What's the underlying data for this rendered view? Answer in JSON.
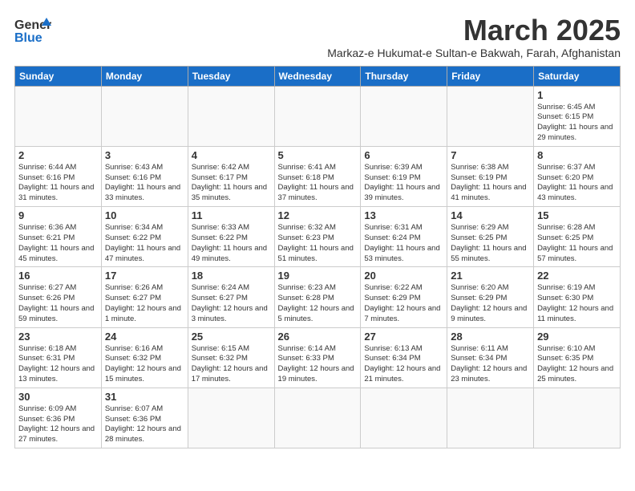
{
  "header": {
    "logo_line1": "General",
    "logo_line2": "Blue",
    "main_title": "March 2025",
    "subtitle": "Markaz-e Hukumat-e Sultan-e Bakwah, Farah, Afghanistan"
  },
  "days_of_week": [
    "Sunday",
    "Monday",
    "Tuesday",
    "Wednesday",
    "Thursday",
    "Friday",
    "Saturday"
  ],
  "weeks": [
    [
      {
        "day": "",
        "info": ""
      },
      {
        "day": "",
        "info": ""
      },
      {
        "day": "",
        "info": ""
      },
      {
        "day": "",
        "info": ""
      },
      {
        "day": "",
        "info": ""
      },
      {
        "day": "",
        "info": ""
      },
      {
        "day": "1",
        "info": "Sunrise: 6:45 AM\nSunset: 6:15 PM\nDaylight: 11 hours and 29 minutes."
      }
    ],
    [
      {
        "day": "2",
        "info": "Sunrise: 6:44 AM\nSunset: 6:16 PM\nDaylight: 11 hours and 31 minutes."
      },
      {
        "day": "3",
        "info": "Sunrise: 6:43 AM\nSunset: 6:16 PM\nDaylight: 11 hours and 33 minutes."
      },
      {
        "day": "4",
        "info": "Sunrise: 6:42 AM\nSunset: 6:17 PM\nDaylight: 11 hours and 35 minutes."
      },
      {
        "day": "5",
        "info": "Sunrise: 6:41 AM\nSunset: 6:18 PM\nDaylight: 11 hours and 37 minutes."
      },
      {
        "day": "6",
        "info": "Sunrise: 6:39 AM\nSunset: 6:19 PM\nDaylight: 11 hours and 39 minutes."
      },
      {
        "day": "7",
        "info": "Sunrise: 6:38 AM\nSunset: 6:19 PM\nDaylight: 11 hours and 41 minutes."
      },
      {
        "day": "8",
        "info": "Sunrise: 6:37 AM\nSunset: 6:20 PM\nDaylight: 11 hours and 43 minutes."
      }
    ],
    [
      {
        "day": "9",
        "info": "Sunrise: 6:36 AM\nSunset: 6:21 PM\nDaylight: 11 hours and 45 minutes."
      },
      {
        "day": "10",
        "info": "Sunrise: 6:34 AM\nSunset: 6:22 PM\nDaylight: 11 hours and 47 minutes."
      },
      {
        "day": "11",
        "info": "Sunrise: 6:33 AM\nSunset: 6:22 PM\nDaylight: 11 hours and 49 minutes."
      },
      {
        "day": "12",
        "info": "Sunrise: 6:32 AM\nSunset: 6:23 PM\nDaylight: 11 hours and 51 minutes."
      },
      {
        "day": "13",
        "info": "Sunrise: 6:31 AM\nSunset: 6:24 PM\nDaylight: 11 hours and 53 minutes."
      },
      {
        "day": "14",
        "info": "Sunrise: 6:29 AM\nSunset: 6:25 PM\nDaylight: 11 hours and 55 minutes."
      },
      {
        "day": "15",
        "info": "Sunrise: 6:28 AM\nSunset: 6:25 PM\nDaylight: 11 hours and 57 minutes."
      }
    ],
    [
      {
        "day": "16",
        "info": "Sunrise: 6:27 AM\nSunset: 6:26 PM\nDaylight: 11 hours and 59 minutes."
      },
      {
        "day": "17",
        "info": "Sunrise: 6:26 AM\nSunset: 6:27 PM\nDaylight: 12 hours and 1 minute."
      },
      {
        "day": "18",
        "info": "Sunrise: 6:24 AM\nSunset: 6:27 PM\nDaylight: 12 hours and 3 minutes."
      },
      {
        "day": "19",
        "info": "Sunrise: 6:23 AM\nSunset: 6:28 PM\nDaylight: 12 hours and 5 minutes."
      },
      {
        "day": "20",
        "info": "Sunrise: 6:22 AM\nSunset: 6:29 PM\nDaylight: 12 hours and 7 minutes."
      },
      {
        "day": "21",
        "info": "Sunrise: 6:20 AM\nSunset: 6:29 PM\nDaylight: 12 hours and 9 minutes."
      },
      {
        "day": "22",
        "info": "Sunrise: 6:19 AM\nSunset: 6:30 PM\nDaylight: 12 hours and 11 minutes."
      }
    ],
    [
      {
        "day": "23",
        "info": "Sunrise: 6:18 AM\nSunset: 6:31 PM\nDaylight: 12 hours and 13 minutes."
      },
      {
        "day": "24",
        "info": "Sunrise: 6:16 AM\nSunset: 6:32 PM\nDaylight: 12 hours and 15 minutes."
      },
      {
        "day": "25",
        "info": "Sunrise: 6:15 AM\nSunset: 6:32 PM\nDaylight: 12 hours and 17 minutes."
      },
      {
        "day": "26",
        "info": "Sunrise: 6:14 AM\nSunset: 6:33 PM\nDaylight: 12 hours and 19 minutes."
      },
      {
        "day": "27",
        "info": "Sunrise: 6:13 AM\nSunset: 6:34 PM\nDaylight: 12 hours and 21 minutes."
      },
      {
        "day": "28",
        "info": "Sunrise: 6:11 AM\nSunset: 6:34 PM\nDaylight: 12 hours and 23 minutes."
      },
      {
        "day": "29",
        "info": "Sunrise: 6:10 AM\nSunset: 6:35 PM\nDaylight: 12 hours and 25 minutes."
      }
    ],
    [
      {
        "day": "30",
        "info": "Sunrise: 6:09 AM\nSunset: 6:36 PM\nDaylight: 12 hours and 27 minutes."
      },
      {
        "day": "31",
        "info": "Sunrise: 6:07 AM\nSunset: 6:36 PM\nDaylight: 12 hours and 28 minutes."
      },
      {
        "day": "",
        "info": ""
      },
      {
        "day": "",
        "info": ""
      },
      {
        "day": "",
        "info": ""
      },
      {
        "day": "",
        "info": ""
      },
      {
        "day": "",
        "info": ""
      }
    ]
  ]
}
